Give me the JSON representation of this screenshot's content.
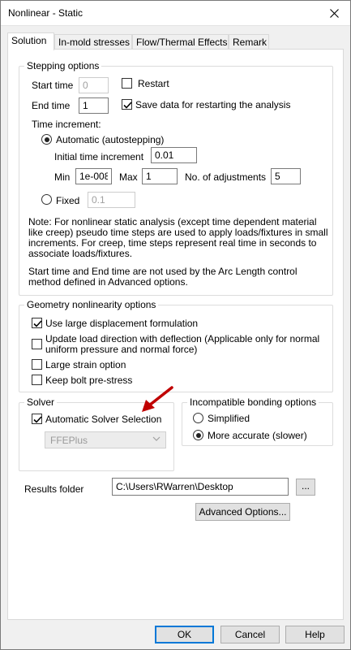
{
  "window": {
    "title": "Nonlinear - Static"
  },
  "tabs": [
    {
      "label": "Solution"
    },
    {
      "label": "In-mold stresses"
    },
    {
      "label": "Flow/Thermal Effects"
    },
    {
      "label": "Remark"
    }
  ],
  "stepping": {
    "legend": "Stepping options",
    "start_time_label": "Start time",
    "start_time_value": "0",
    "restart_label": "Restart",
    "end_time_label": "End time",
    "end_time_value": "1",
    "save_data_label": "Save data for restarting the analysis",
    "time_increment_label": "Time increment:",
    "automatic_label": "Automatic (autostepping)",
    "initial_increment_label": "Initial time increment",
    "initial_increment_value": "0.01",
    "min_label": "Min",
    "min_value": "1e-008",
    "max_label": "Max",
    "max_value": "1",
    "adjustments_label": "No. of adjustments",
    "adjustments_value": "5",
    "fixed_label": "Fixed",
    "fixed_value": "0.1",
    "note1": "Note: For nonlinear static analysis (except time dependent material like creep) pseudo time steps are used to apply loads/fixtures in small increments. For creep, time steps represent real time in seconds to associate loads/fixtures.",
    "note2": "Start time and End time  are not used by the Arc Length control method defined in Advanced options."
  },
  "geometry": {
    "legend": "Geometry nonlinearity options",
    "large_disp_label": "Use large displacement formulation",
    "update_load_label": "Update load direction with deflection (Applicable only for normal uniform pressure and normal force)",
    "large_strain_label": "Large strain option",
    "bolt_label": "Keep bolt pre-stress"
  },
  "solver": {
    "legend": "Solver",
    "auto_label": "Automatic Solver Selection",
    "selected": "FFEPlus"
  },
  "bonding": {
    "legend": "Incompatible bonding options",
    "simplified_label": "Simplified",
    "accurate_label": "More accurate (slower)"
  },
  "results": {
    "label": "Results folder",
    "path": "C:\\Users\\RWarren\\Desktop",
    "browse_label": "..."
  },
  "advanced_label": "Advanced Options...",
  "footer": {
    "ok": "OK",
    "cancel": "Cancel",
    "help": "Help"
  },
  "colors": {
    "accent": "#0078d7",
    "arrow": "#c00000"
  }
}
